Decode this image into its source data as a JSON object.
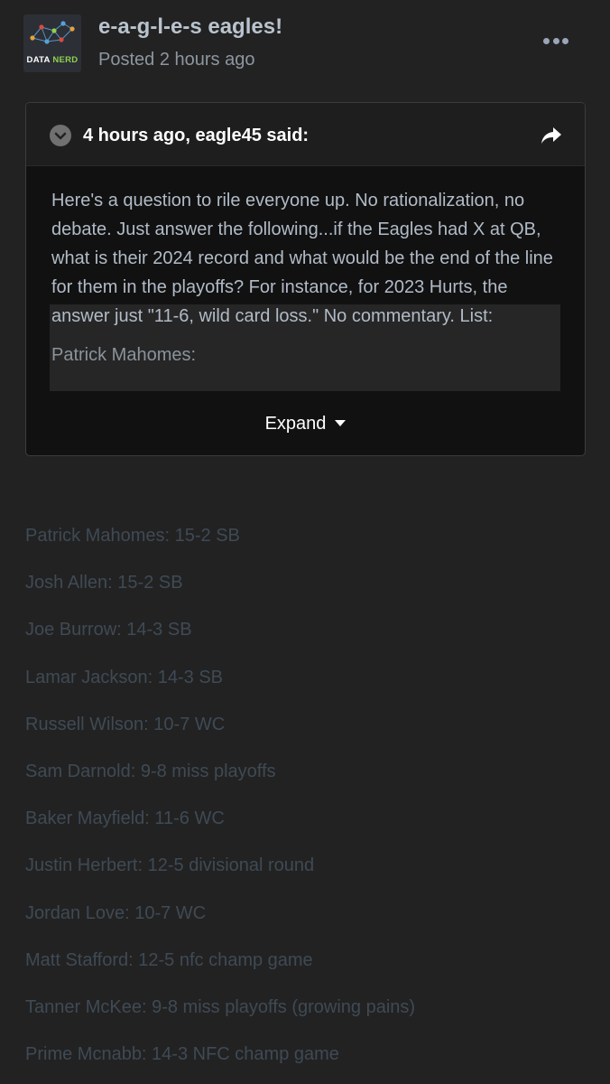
{
  "post": {
    "author": "e-a-g-l-e-s eagles!",
    "posted": "Posted 2 hours ago",
    "avatar": {
      "word1": "DATA",
      "word2": "NERD"
    },
    "more_icon": "ellipsis-icon"
  },
  "quote": {
    "title": "4 hours ago, eagle45 said:",
    "toggle_icon": "chevron-down-circle-icon",
    "share_icon": "share-arrow-icon",
    "body": "Here's a question to rile everyone up.  No rationalization, no debate.  Just answer the following...if the Eagles had X at QB, what is their 2024 record and what would be the end of the line for them in the playoffs?  For instance, for 2023 Hurts, the answer just \"11-6, wild card loss.\"  No commentary.  List:",
    "body_line2": "Patrick Mahomes:",
    "expand_label": "Expand"
  },
  "list": [
    "Patrick Mahomes: 15-2 SB",
    "Josh Allen: 15-2 SB",
    "Joe Burrow: 14-3 SB",
    "Lamar Jackson: 14-3 SB",
    "Russell Wilson: 10-7 WC",
    "Sam Darnold: 9-8 miss playoffs",
    "Baker Mayfield: 11-6 WC",
    "Justin Herbert: 12-5 divisional round",
    "Jordan Love: 10-7 WC",
    "Matt Stafford: 12-5 nfc champ game",
    "Tanner McKee: 9-8 miss playoffs (growing pains)",
    "Prime Mcnabb: 14-3 NFC champ game"
  ],
  "colors": {
    "background": "#222222",
    "quote_bg": "#111111",
    "muted_text": "#3f4a55",
    "avatar_accent": "#8fd14f"
  }
}
